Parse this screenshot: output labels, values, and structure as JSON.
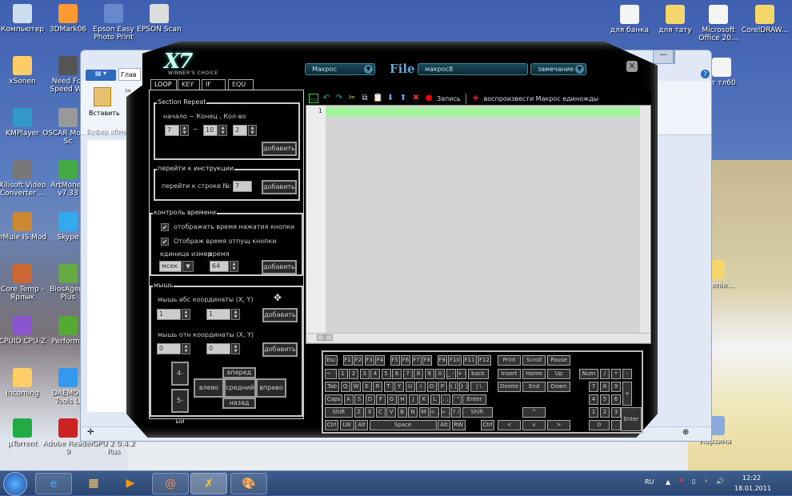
{
  "desktop": {
    "left_icons": [
      "Компьютер",
      "3DMark06",
      "Epson Easy Photo Print",
      "EPSON Scan",
      "xSonen",
      "Need For Speed Wo",
      "KMPlayer",
      "OSCAR Mouse Sc",
      "Xilisoft Video Converter ...",
      "ArtMoney v7.33",
      "eMule IS Mod",
      "Skype",
      "Core Temp - Ярлык",
      "BiosAgent Plus",
      "CPUID CPU-Z",
      "Performa",
      "Incoming",
      "DAEMON Tools Li",
      "µTorrent",
      "Adobe Reader 9",
      "GPU 2 0.4.2 Rus"
    ],
    "right_icons": [
      "для банка",
      "для тату",
      "Microsoft Office 20...",
      "CorelDRAW...",
      "ст тл60",
      "...chenie...",
      "Корзина"
    ]
  },
  "wordpad": {
    "menu_button": "▤ ▾",
    "tab_home": "Глав",
    "paste_label": "Вставить",
    "clipboard_group": "Буфер обмен",
    "min": "—",
    "max": "☐",
    "close": "✕",
    "help": "?"
  },
  "app": {
    "logo": "X7",
    "logo_sub": "WINNER'S CHOICE",
    "mode_dropdown": "Макрос",
    "file_label": "File",
    "file_name": "макрос8",
    "note_dropdown": "замечание",
    "close": "✕",
    "tabs": [
      "LOOP",
      "KEY",
      "IF",
      "EQU"
    ],
    "section_repeat": {
      "title": "Section Repeat",
      "label": "начало ~ Конец , Кол-во",
      "start": "7",
      "tilde": "~",
      "end": "10",
      "count": "2",
      "add": "добавить"
    },
    "goto": {
      "title": "перейти к инструкции",
      "label": "перейти к строке №:",
      "line": "7",
      "add": "добавить"
    },
    "time": {
      "title": "контроль времени",
      "check1": "отображать время нажатия кнопки",
      "check1_checked": true,
      "check2": "Отображ время отпущ кнопки",
      "check2_checked": true,
      "unit_label": "единица измер",
      "time_label": "время",
      "unit": "мсек",
      "time": "64",
      "add": "добавить"
    },
    "mouse": {
      "title": "мышь",
      "abs_label": "мышь абс координаты (X, Y)",
      "abs_x": "1",
      "abs_y": "1",
      "rel_label": "мышь отн координаты (X, Y)",
      "rel_x": "0",
      "rel_y": "0",
      "add": "добавить",
      "btn4": "4-ый",
      "btn5": "5-ый",
      "forward": "вперед",
      "left": "влево",
      "middle": "средний",
      "right": "вправо",
      "back": "назад"
    },
    "toolbar": {
      "record": "Запись",
      "play_once": "воспроизвести Макрос единожды"
    },
    "editor": {
      "line_numbers": [
        "1"
      ],
      "hscroll": "|||"
    },
    "keyboard": {
      "main": [
        [
          "Esc",
          "F1",
          "F2",
          "F3",
          "F4",
          "F5",
          "F6",
          "F7",
          "F8",
          "F9",
          "F10",
          "F11",
          "F12"
        ],
        [
          "~ `",
          "1",
          "2",
          "3",
          "4",
          "5",
          "6",
          "7",
          "8",
          "9",
          "0",
          "_ -",
          "+ =",
          "back"
        ],
        [
          "Tab",
          "Q",
          "W",
          "E",
          "R",
          "T",
          "Y",
          "U",
          "I",
          "O",
          "P",
          "{ [",
          "} ]",
          "| \\"
        ],
        [
          "Caps",
          "A",
          "S",
          "D",
          "F",
          "G",
          "H",
          "J",
          "K",
          "L",
          ": ;",
          "' \"",
          "Enter"
        ],
        [
          "Shift",
          "Z",
          "X",
          "C",
          "V",
          "B",
          "N",
          "M",
          "< ,",
          "> .",
          "? /",
          "Shift"
        ],
        [
          "Ctrl",
          "LW",
          "Alt",
          "Space",
          "Alt",
          "RW",
          "Ctrl"
        ]
      ],
      "sys": [
        "Print",
        "Scroll",
        "Pause"
      ],
      "nav": [
        "Insert",
        "Home",
        "Up",
        "Delete",
        "End",
        "Down"
      ],
      "arrows": [
        "^",
        "<",
        "v",
        ">"
      ],
      "numpad": [
        "Num",
        "/",
        "*",
        "-",
        "7",
        "8",
        "9",
        "+",
        "4",
        "5",
        "6",
        "1",
        "2",
        "3",
        "Enter",
        "0",
        "."
      ]
    }
  },
  "taskbar": {
    "lang": "RU",
    "time": "12:22",
    "date": "18.01.2011"
  },
  "colors": {
    "accent": "#3a8aa0",
    "current_line": "#a3f39a"
  }
}
